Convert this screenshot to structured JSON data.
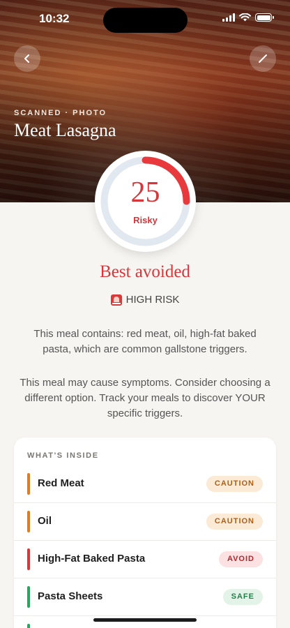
{
  "status": {
    "time": "10:32"
  },
  "header": {
    "source_label": "SCANNED · PHOTO",
    "meal_name": "Meat Lasagna"
  },
  "score": {
    "value": "25",
    "max": 100,
    "label": "Risky",
    "color": "#d8363a"
  },
  "verdict": "Best avoided",
  "risk": {
    "icon": "siren-icon",
    "label": "HIGH RISK"
  },
  "explanation": "This meal contains: red meat, oil, high-fat baked pasta, which are common gallstone triggers.",
  "advice": "This meal may cause symptoms. Consider choosing a different option. Track your meals to discover YOUR specific triggers.",
  "ingredients": {
    "title": "WHAT'S INSIDE",
    "items": [
      {
        "name": "Red Meat",
        "badge": "CAUTION",
        "level": "caution",
        "color": "#e07b24"
      },
      {
        "name": "Oil",
        "badge": "CAUTION",
        "level": "caution",
        "color": "#e07b24"
      },
      {
        "name": "High-Fat Baked Pasta",
        "badge": "AVOID",
        "level": "avoid",
        "color": "#d8363a"
      },
      {
        "name": "Pasta Sheets",
        "badge": "SAFE",
        "level": "safe",
        "color": "#2aa55e"
      }
    ]
  }
}
